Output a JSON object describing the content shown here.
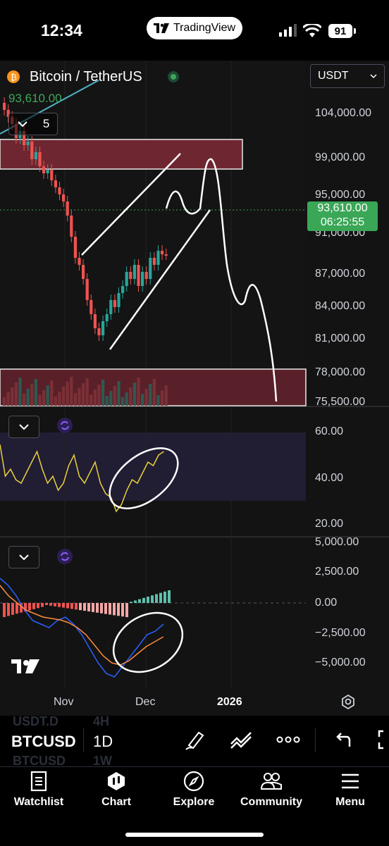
{
  "status_bar": {
    "time": "12:34",
    "app_pill": "TradingView",
    "battery": "91"
  },
  "chart": {
    "symbol_title": "Bitcoin / TetherUS",
    "last_price_small": "93,610.00",
    "collapse_count": "5",
    "currency_selector": "USDT",
    "price_tag_value": "93,610.00",
    "price_tag_countdown": "06:25:55",
    "price_axis": [
      "104,000.00",
      "99,000.00",
      "95,000.00",
      "91,000.00",
      "87,000.00",
      "84,000.00",
      "81,000.00",
      "78,000.00",
      "75,500.00"
    ],
    "rsi_axis": [
      "60.00",
      "40.00",
      "20.00"
    ],
    "macd_axis": [
      "5,000.00",
      "2,500.00",
      "0.00",
      "−2,500.00",
      "−5,000.00"
    ],
    "time_axis": [
      "Nov",
      "Dec",
      "2026"
    ],
    "colors": {
      "up": "#26a69a",
      "down": "#ef5350",
      "rsi": "#e8d13b",
      "macd": "#2962ff",
      "signal": "#ff8a3c",
      "price_tag": "#3aa757",
      "zone": "#7a2a33"
    }
  },
  "toolbar": {
    "symbol": "BTCUSD",
    "interval": "1D",
    "ghost_symbol_top": "USDT.D",
    "ghost_interval_top": "4H",
    "ghost_symbol_bottom": "BTCUSD",
    "ghost_interval_bottom": "1W"
  },
  "bottom_nav": [
    {
      "label": "Watchlist",
      "icon": "watchlist-icon"
    },
    {
      "label": "Chart",
      "icon": "chart-icon"
    },
    {
      "label": "Explore",
      "icon": "compass-icon"
    },
    {
      "label": "Community",
      "icon": "community-icon"
    },
    {
      "label": "Menu",
      "icon": "menu-icon"
    }
  ]
}
